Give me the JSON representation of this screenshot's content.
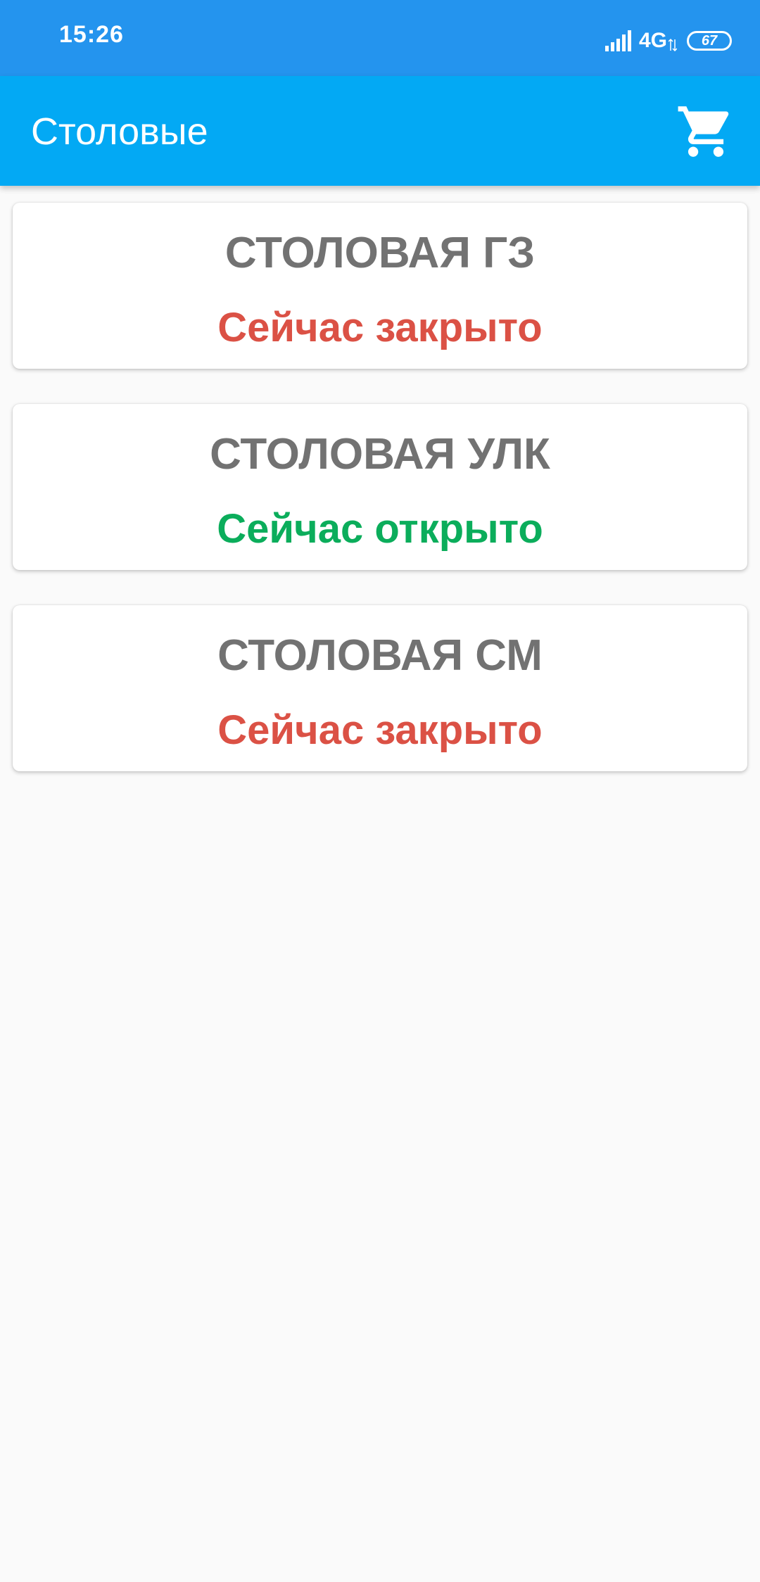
{
  "status_bar": {
    "time": "15:26",
    "network": "4G",
    "battery": "67",
    "icons": [
      "signal-icon",
      "network-arrows-icon",
      "battery-icon"
    ]
  },
  "app_bar": {
    "title": "Столовые",
    "cart_icon": "cart-icon"
  },
  "colors": {
    "status_bar": "#2494EE",
    "app_bar": "#03A9F4",
    "background": "#FAFAFA",
    "title_gray": "#727272",
    "closed_red": "#DB5145",
    "open_green": "#0BAD5B"
  },
  "canteens": [
    {
      "name": "СТОЛОВАЯ ГЗ",
      "status": "Сейчас закрыто",
      "is_open": false
    },
    {
      "name": "СТОЛОВАЯ УЛК",
      "status": "Сейчас открыто",
      "is_open": true
    },
    {
      "name": "СТОЛОВАЯ СМ",
      "status": "Сейчас закрыто",
      "is_open": false
    }
  ]
}
